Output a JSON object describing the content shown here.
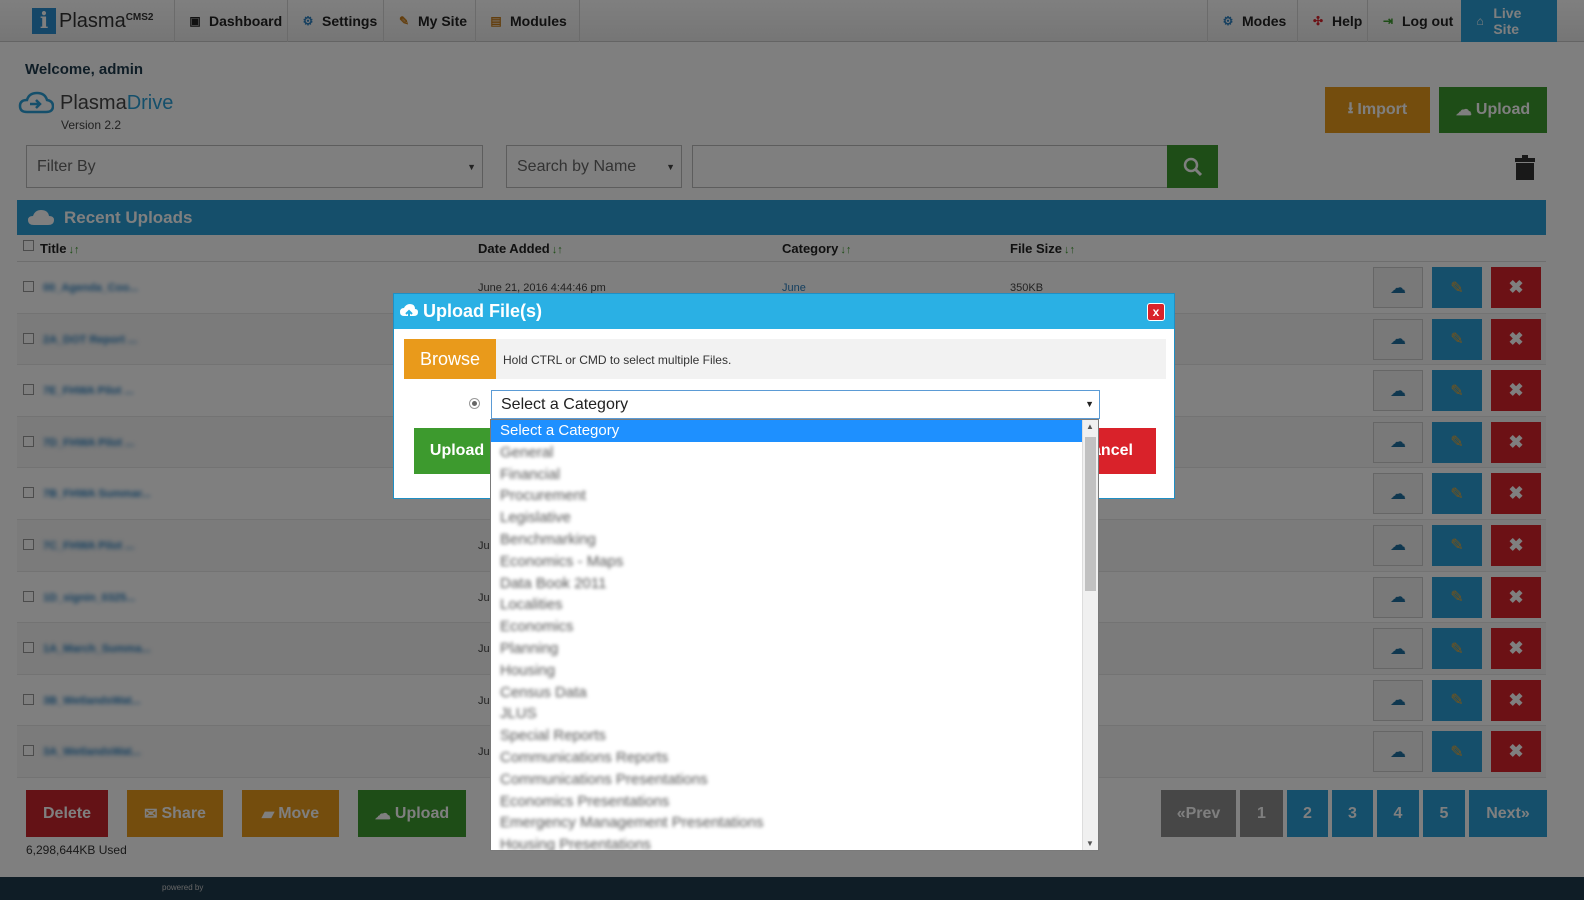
{
  "nav": {
    "logo_name": "Plasma",
    "logo_suffix": "CMS2",
    "items": [
      "Dashboard",
      "Settings",
      "My Site",
      "Modules"
    ],
    "right_items": [
      "Modes",
      "Help",
      "Log out",
      "Live Site"
    ]
  },
  "welcome": "Welcome, admin",
  "brand": {
    "name_a": "Plasma",
    "name_b": "Drive",
    "version": "Version 2.2"
  },
  "buttons": {
    "import": "Import",
    "upload": "Upload"
  },
  "filters": {
    "filter_by": "Filter By",
    "search_by": "Search by Name"
  },
  "panel": {
    "title": "Recent Uploads",
    "columns": [
      "Title",
      "Date Added",
      "Category",
      "File Size"
    ]
  },
  "rows": [
    {
      "title": "00_Agenda_Coo...",
      "date": "June 21, 2016 4:44:46 pm",
      "cat": "June",
      "size": "350KB"
    },
    {
      "title": "2A_DOT Report ...",
      "date": "",
      "cat": "",
      "size": ""
    },
    {
      "title": "7E_FHWA Pilot ...",
      "date": "",
      "cat": "",
      "size": ""
    },
    {
      "title": "7D_FHWA Pilot ...",
      "date": "",
      "cat": "",
      "size": ""
    },
    {
      "title": "7B_FHWA Summar...",
      "date": "",
      "cat": "",
      "size": ""
    },
    {
      "title": "7C_FHWA Pilot ...",
      "date": "Ju",
      "cat": "",
      "size": ""
    },
    {
      "title": "1D_signin_0325...",
      "date": "Ju",
      "cat": "",
      "size": ""
    },
    {
      "title": "1A_March_Summa...",
      "date": "Ju",
      "cat": "",
      "size": ""
    },
    {
      "title": "3B_WetlandsWat...",
      "date": "Ju",
      "cat": "",
      "size": ""
    },
    {
      "title": "3A_WetlandsWat...",
      "date": "Ju",
      "cat": "",
      "size": ""
    }
  ],
  "bottom": {
    "delete": "Delete",
    "share": "Share",
    "move": "Move",
    "upload": "Upload",
    "used": "6,298,644KB Used"
  },
  "pagination": {
    "prev": "«Prev",
    "pages": [
      "1",
      "2",
      "3",
      "4",
      "5"
    ],
    "next": "Next»"
  },
  "footer": {
    "powered": "powered by"
  },
  "modal": {
    "title": "Upload File(s)",
    "close": "x",
    "browse": "Browse",
    "hint": "Hold CTRL or CMD to select multiple Files.",
    "category_selected": "Select a Category",
    "upload": "Upload",
    "cancel": "ancel"
  },
  "dropdown_options": [
    "Select a Category",
    "General",
    "Financial",
    "Procurement",
    "Legislative",
    "Benchmarking",
    "Economics - Maps",
    "Data Book 2011",
    "Localities",
    "Economics",
    "Planning",
    "Housing",
    "Census Data",
    "JLUS",
    "Special Reports",
    "Communications Reports",
    "Communications Presentations",
    "Economics Presentations",
    "Emergency Management Presentations",
    "Housing Presentations"
  ],
  "colors": {
    "accent": "#2a9fd6",
    "green": "#3d9a2e",
    "orange": "#e99a1b",
    "red": "#d9222a"
  }
}
